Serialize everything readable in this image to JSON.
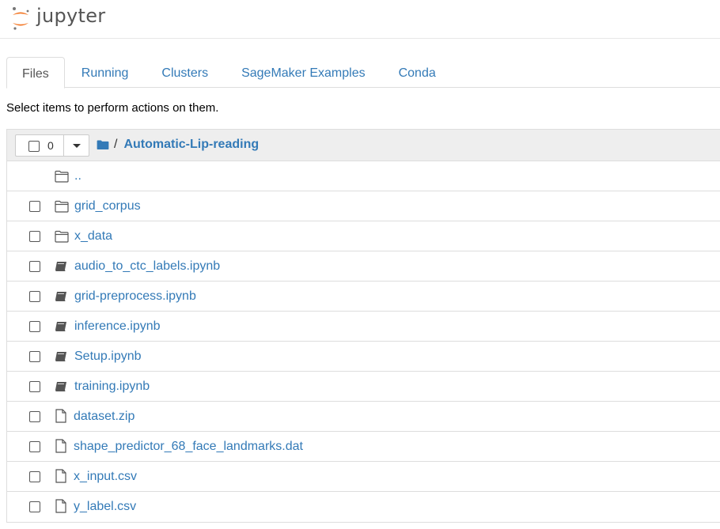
{
  "header": {
    "logo_text": "jupyter"
  },
  "tabs": [
    {
      "label": "Files",
      "active": true
    },
    {
      "label": "Running",
      "active": false
    },
    {
      "label": "Clusters",
      "active": false
    },
    {
      "label": "SageMaker Examples",
      "active": false
    },
    {
      "label": "Conda",
      "active": false
    }
  ],
  "instructions": "Select items to perform actions on them.",
  "list_header": {
    "selected_count": "0",
    "breadcrumb_separator": "/",
    "breadcrumb_current": "Automatic-Lip-reading"
  },
  "items": [
    {
      "name": "..",
      "type": "folder-up",
      "icon": "folder-icon"
    },
    {
      "name": "grid_corpus",
      "type": "folder",
      "icon": "folder-icon"
    },
    {
      "name": "x_data",
      "type": "folder",
      "icon": "folder-icon"
    },
    {
      "name": "audio_to_ctc_labels.ipynb",
      "type": "notebook",
      "icon": "notebook-icon"
    },
    {
      "name": "grid-preprocess.ipynb",
      "type": "notebook",
      "icon": "notebook-icon"
    },
    {
      "name": "inference.ipynb",
      "type": "notebook",
      "icon": "notebook-icon"
    },
    {
      "name": "Setup.ipynb",
      "type": "notebook",
      "icon": "notebook-icon"
    },
    {
      "name": "training.ipynb",
      "type": "notebook",
      "icon": "notebook-icon"
    },
    {
      "name": "dataset.zip",
      "type": "file",
      "icon": "file-icon"
    },
    {
      "name": "shape_predictor_68_face_landmarks.dat",
      "type": "file",
      "icon": "file-icon"
    },
    {
      "name": "x_input.csv",
      "type": "file",
      "icon": "file-icon"
    },
    {
      "name": "y_label.csv",
      "type": "file",
      "icon": "file-icon"
    }
  ],
  "colors": {
    "link": "#337ab7",
    "logo_orange": "#f37726",
    "header_bg": "#eeeeee"
  }
}
